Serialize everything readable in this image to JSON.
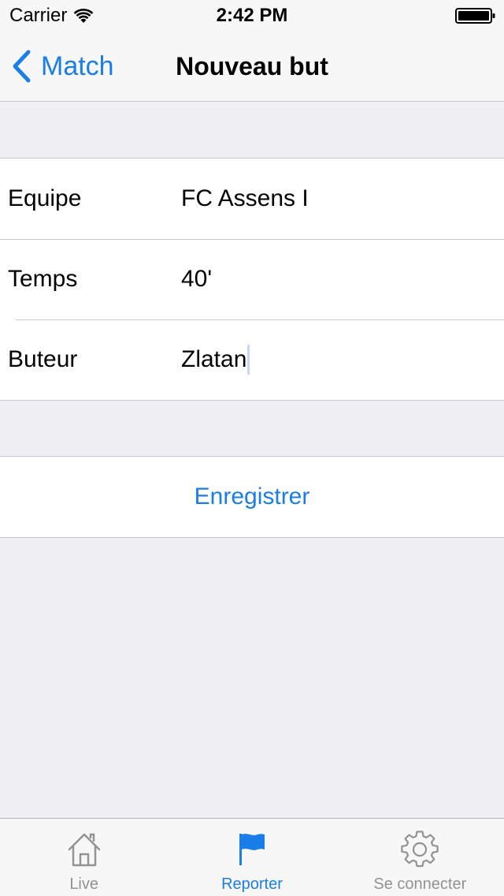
{
  "status_bar": {
    "carrier": "Carrier",
    "time": "2:42 PM"
  },
  "nav": {
    "back_label": "Match",
    "title": "Nouveau but"
  },
  "form": {
    "rows": [
      {
        "label": "Equipe",
        "value": "FC Assens I"
      },
      {
        "label": "Temps",
        "value": "40'"
      },
      {
        "label": "Buteur",
        "value": "Zlatan"
      }
    ]
  },
  "save_button": {
    "label": "Enregistrer"
  },
  "tab_bar": {
    "items": [
      {
        "label": "Live",
        "icon": "home-icon",
        "active": false
      },
      {
        "label": "Reporter",
        "icon": "flag-icon",
        "active": true
      },
      {
        "label": "Se connecter",
        "icon": "gear-icon",
        "active": false
      }
    ]
  },
  "colors": {
    "accent": "#1a7ee8",
    "background": "#efeff4",
    "inactive_tab": "#929292"
  }
}
